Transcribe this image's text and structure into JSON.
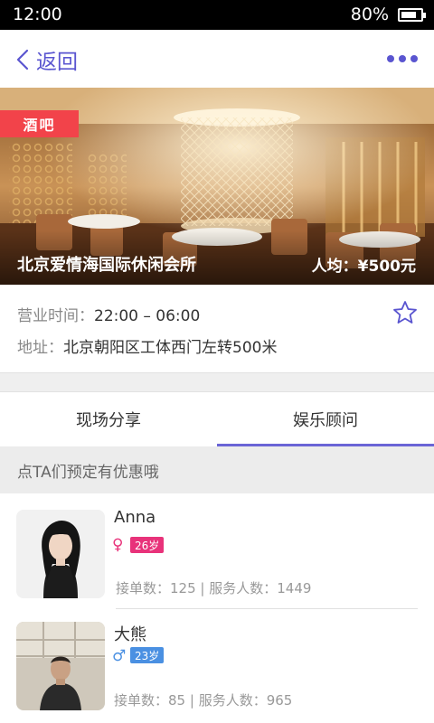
{
  "status_bar": {
    "time": "12:00",
    "battery_text": "80%",
    "battery_level": 0.8
  },
  "nav": {
    "back_label": "返回",
    "more_icon": "more-dots-icon",
    "accent_color": "#5a55d0"
  },
  "venue": {
    "tag": "酒吧",
    "name": "北京爱情海国际休闲会所",
    "price": "人均：¥500元",
    "hours_label": "营业时间：",
    "hours_value": "22:00 – 06:00",
    "address_label": "地址：",
    "address_value": "北京朝阳区工体西门左转500米",
    "favorite_icon": "star-outline-icon"
  },
  "tabs": [
    {
      "label": "现场分享",
      "active": false
    },
    {
      "label": "娱乐顾问",
      "active": true
    }
  ],
  "promo_text": "点TA们预定有优惠哦",
  "advisors": [
    {
      "name": "Anna",
      "gender": "female",
      "gender_symbol": "♀",
      "age": "26岁",
      "orders": "接单数：125",
      "served": "| 服务人数：1449",
      "badge_color": "#e8327a"
    },
    {
      "name": "大熊",
      "gender": "male",
      "gender_symbol": "♂",
      "age": "23岁",
      "orders": "接单数：85",
      "served": "| 服务人数：965",
      "badge_color": "#4a90e2"
    }
  ]
}
